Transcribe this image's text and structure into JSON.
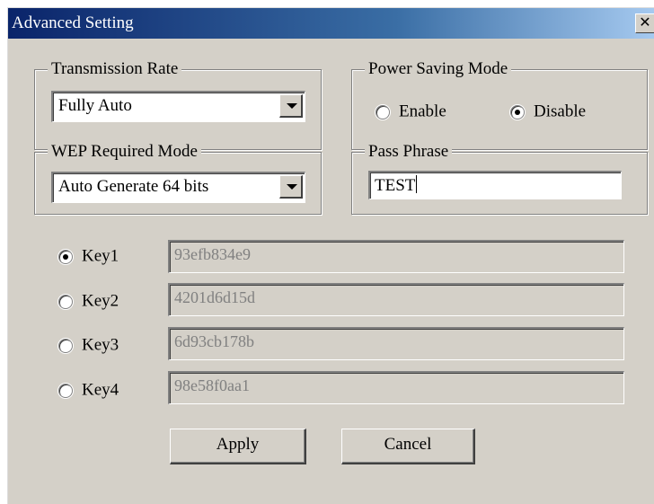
{
  "window": {
    "title": "Advanced Setting"
  },
  "transmission_rate": {
    "label": "Transmission Rate",
    "value": "Fully Auto"
  },
  "power_saving": {
    "label": "Power Saving Mode",
    "enable_label": "Enable",
    "disable_label": "Disable",
    "selected": "Disable"
  },
  "wep_mode": {
    "label": "WEP Required Mode",
    "value": "Auto Generate 64 bits"
  },
  "pass_phrase": {
    "label": "Pass Phrase",
    "value": "TEST"
  },
  "keys": [
    {
      "label": "Key1",
      "value": "93efb834e9",
      "selected": true
    },
    {
      "label": "Key2",
      "value": "4201d6d15d",
      "selected": false
    },
    {
      "label": "Key3",
      "value": "6d93cb178b",
      "selected": false
    },
    {
      "label": "Key4",
      "value": "98e58f0aa1",
      "selected": false
    }
  ],
  "buttons": {
    "apply": "Apply",
    "cancel": "Cancel"
  }
}
